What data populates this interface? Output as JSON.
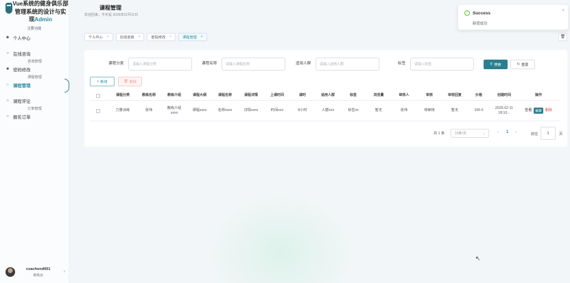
{
  "brand": {
    "title_main": "Vue系统的健身俱乐部管理系统的设计与实现",
    "title_accent": "Admin",
    "section_label": "主要功能"
  },
  "sidebar": {
    "items": [
      {
        "label": "个人中心",
        "icon": "user-icon",
        "sub": ""
      },
      {
        "label": "在线咨询",
        "icon": "circle-icon",
        "sub": "咨询管理"
      },
      {
        "label": "密码修改",
        "icon": "lock-icon",
        "sub": "课程管理"
      },
      {
        "label": "课程管理",
        "icon": "circle-icon",
        "sub": "",
        "active": true
      },
      {
        "label": "课程评论",
        "icon": "circle-icon",
        "sub": "订单管理"
      },
      {
        "label": "报名订单",
        "icon": "circle-icon",
        "sub": ""
      }
    ]
  },
  "user": {
    "name": "coachend001",
    "role": "教练员"
  },
  "header": {
    "title": "课程管理",
    "subtitle": "欢迎回来，今天是 2026年02月11日"
  },
  "tabs": [
    {
      "label": "个人中心",
      "active": false
    },
    {
      "label": "在线咨询",
      "active": false
    },
    {
      "label": "密码修改",
      "active": false
    },
    {
      "label": "课程管理",
      "active": true
    }
  ],
  "filters": [
    {
      "label": "课程分类",
      "placeholder": "请输入课程分类"
    },
    {
      "label": "课程名称",
      "placeholder": "请输入课程名称"
    },
    {
      "label": "适用人群",
      "placeholder": "请输入适用人群"
    },
    {
      "label": "标签",
      "placeholder": "请输入标签"
    }
  ],
  "buttons": {
    "search": "搜索",
    "reset": "重置",
    "add": "新增",
    "delete": "删除"
  },
  "table": {
    "headers": [
      "课程分类",
      "教练名称",
      "教练介绍",
      "课程大纲",
      "课程名称",
      "课程详情",
      "上课时间",
      "课时",
      "适用人群",
      "标签",
      "浏览量",
      "审核人",
      "审核",
      "审核回复",
      "价格",
      "创建时间",
      "操作"
    ],
    "rows": [
      {
        "cells": [
          "力量训练",
          "张伟",
          "教练介绍xxxx",
          "课程xxxx",
          "名称xxxx",
          "详情xxxx",
          "时间xxx",
          "8小时",
          "人群xxx",
          "标签xx",
          "暂无",
          "张伟",
          "待审核",
          "暂无",
          "100.0",
          "2026-02-11 18:10..."
        ],
        "actions": {
          "view": "查看",
          "edit": "编辑",
          "delete": "删除"
        }
      }
    ]
  },
  "pagination": {
    "total_text": "共 1 条",
    "page_size": "10条/页",
    "prev": "‹",
    "current": "1",
    "next": "›",
    "jump_label": "前往",
    "jump_value": "1",
    "jump_unit": "页"
  },
  "toast": {
    "title": "Success",
    "message": "新增成功",
    "close": "×"
  },
  "colors": {
    "accent": "#2e8aa1",
    "primary_button": "#2a7f8f",
    "danger": "#e24b4b",
    "success": "#67c23a"
  }
}
